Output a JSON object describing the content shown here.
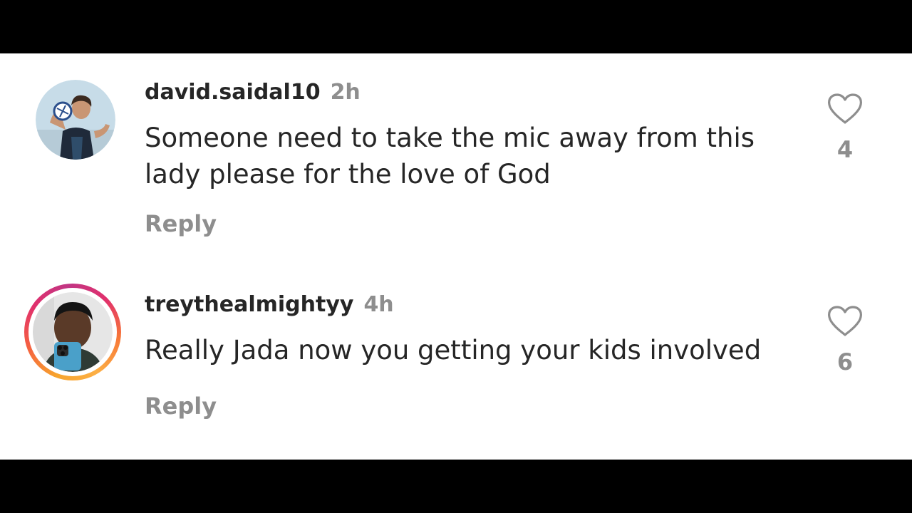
{
  "comments": [
    {
      "username": "david.saidal10",
      "time": "2h",
      "text": "Someone need to take the mic away from this lady please for the love of God",
      "reply_label": "Reply",
      "likes": "4",
      "has_story_ring": false,
      "avatar_icon": "profile-photo-avatar"
    },
    {
      "username": "treythealmightyy",
      "time": "4h",
      "text": "Really Jada now you getting your kids involved",
      "reply_label": "Reply",
      "likes": "6",
      "has_story_ring": true,
      "avatar_icon": "profile-photo-avatar"
    }
  ],
  "icons": {
    "like": "heart-outline-icon"
  },
  "colors": {
    "username": "#262626",
    "secondary_text": "#8e8e8e",
    "background": "#ffffff",
    "letterbox": "#000000"
  }
}
